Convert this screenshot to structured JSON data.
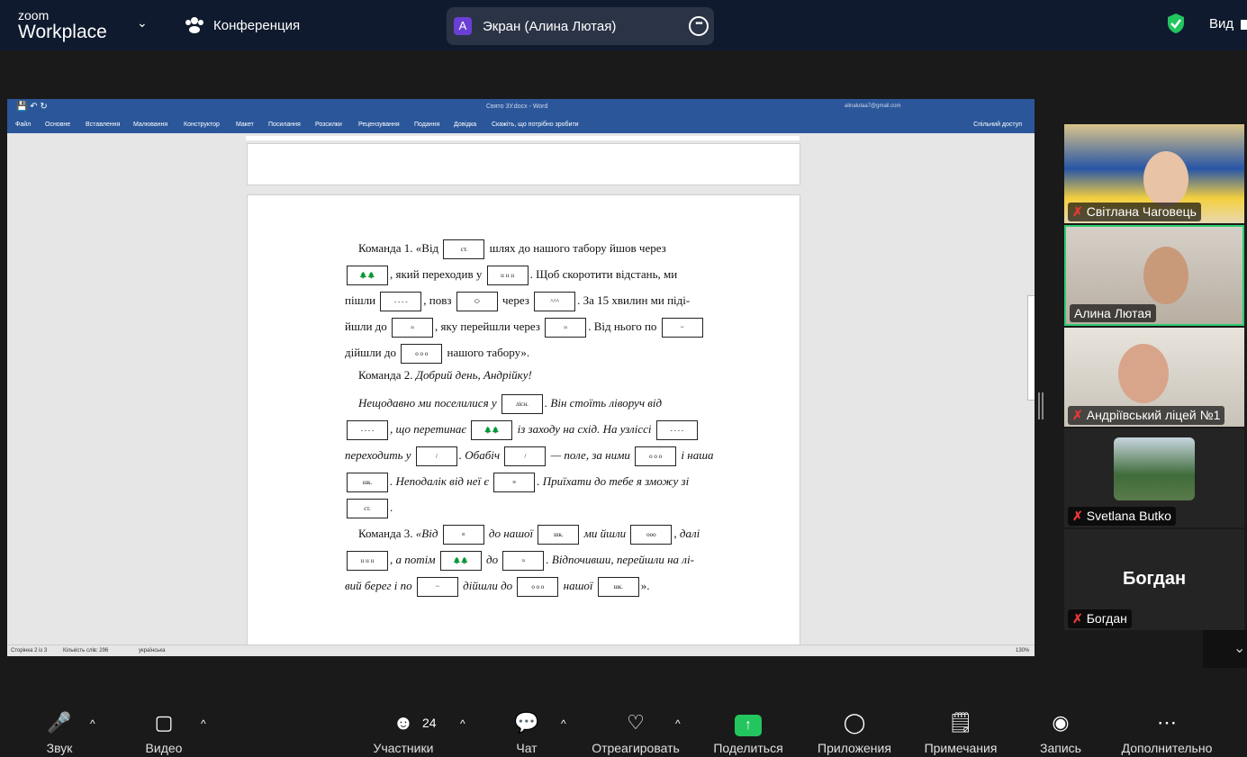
{
  "topbar": {
    "logo_small": "zoom",
    "logo_big": "Workplace",
    "meeting_label": "Конференция",
    "share_avatar": "A",
    "share_label": "Экран (Алина Лютая)",
    "view_label": "Вид"
  },
  "word": {
    "doc_title": "Свято 3У.docx - Word",
    "account": "alinalutaa7@gmail.com",
    "menu": [
      "Файл",
      "Основне",
      "Вставлення",
      "Малювання",
      "Конструктор",
      "Макет",
      "Посилання",
      "Розсилки",
      "Рецензування",
      "Подання",
      "Довідка",
      "Скажіть, що потрібно зробити"
    ],
    "share": "Спільний доступ",
    "status": [
      "Сторінка 2 із 3",
      "Кількість слів: 296",
      "українська"
    ],
    "zoom": "130%",
    "lines": [
      {
        "a": "Команда 1. «Від",
        "b": "шлях до нашого табору йшов через"
      },
      {
        "a": ", який переходив у",
        "b": ". Щоб скоротити відстань, ми"
      },
      {
        "a": "пішли",
        "b": ", повз",
        "c": "через",
        "d": ". За 15 хвилин ми піді-"
      },
      {
        "a": "йшли до",
        "b": ", яку перейшли через",
        "c": ". Від нього по"
      },
      {
        "a": "дійшли до",
        "b": "нашого табору»."
      },
      {
        "a": "Команда 2.",
        "b": "Добрий день, Андрійку!"
      },
      {
        "a": "Нещодавно ми поселилися у",
        "b": ". Він стоїть ліворуч від"
      },
      {
        "a": ", що перетинає",
        "b": "із заходу на схід. На узліссі"
      },
      {
        "a": "переходить у",
        "b": ". Обабіч",
        "c": "— поле, за ними",
        "d": "і наша"
      },
      {
        "a": ". Неподалік від неї є",
        "b": ". Приїхати до тебе я зможу зі"
      },
      {
        "a": "."
      },
      {
        "a": "Команда 3.",
        "b": "«Від",
        "c": "до нашої",
        "d": "ми йшли",
        "e": ", далі"
      },
      {
        "a": ", а потім",
        "b": "до",
        "c": ". Відпочивши, перейшли на лі-"
      },
      {
        "a": "вий берег і по",
        "b": "дійшли до",
        "c": "нашої",
        "d": "»."
      }
    ],
    "icon_labels": {
      "lis": "лісн.",
      "shk": "шк.",
      "st": "ст."
    }
  },
  "participants": [
    {
      "name": "Світлана Чаговець",
      "muted": true
    },
    {
      "name": "Алина Лютая",
      "muted": false
    },
    {
      "name": "Андріївський ліцей №1",
      "muted": true
    },
    {
      "name": "Svetlana Butko",
      "muted": true
    },
    {
      "name": "Богдан",
      "muted": true
    }
  ],
  "toolbar": {
    "audio": "Звук",
    "video": "Видео",
    "participants": "Участники",
    "participants_count": "24",
    "chat": "Чат",
    "react": "Отреагировать",
    "share": "Поделиться",
    "apps": "Приложения",
    "notes": "Примечания",
    "record": "Запись",
    "more": "Дополнительно"
  }
}
